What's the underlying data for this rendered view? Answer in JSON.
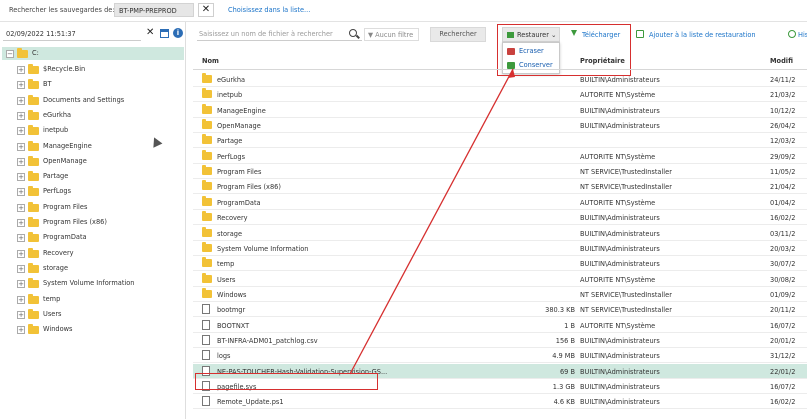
{
  "topbar": {
    "search_label": "Rechercher les sauvegardes de:",
    "server": "BT-PMP-PREPROD",
    "clear": "✕",
    "choose_link": "Choisissez dans la liste..."
  },
  "left": {
    "date": "02/09/2022 11:51:37",
    "clear": "✕",
    "info": "i",
    "root": "C:",
    "items": [
      "$Recycle.Bin",
      "BT",
      "Documents and Settings",
      "eGurkha",
      "inetpub",
      "ManageEngine",
      "OpenManage",
      "Partage",
      "PerfLogs",
      "Program Files",
      "Program Files (x86)",
      "ProgramData",
      "Recovery",
      "storage",
      "System Volume Information",
      "temp",
      "Users",
      "Windows"
    ]
  },
  "toolbar": {
    "search_placeholder": "Saisissez un nom de fichier à rechercher",
    "filter": "Aucun filtre",
    "search_button": "Rechercher",
    "restore": "Restaurer",
    "restore_menu": [
      "Ecraser",
      "Conserver"
    ],
    "download": "Télécharger",
    "add_to_list": "Ajouter à la liste de restauration",
    "history": "Histo"
  },
  "table": {
    "headers": {
      "name": "Nom",
      "owner": "Propriétaire",
      "modified": "Modifi"
    },
    "rows": [
      {
        "name": "eGurkha",
        "type": "folder",
        "size": "",
        "owner": "BUILTIN\\Administrateurs",
        "mod": "24/11/2"
      },
      {
        "name": "inetpub",
        "type": "folder",
        "size": "",
        "owner": "AUTORITE NT\\Système",
        "mod": "21/03/2"
      },
      {
        "name": "ManageEngine",
        "type": "folder",
        "size": "",
        "owner": "BUILTIN\\Administrateurs",
        "mod": "10/12/2"
      },
      {
        "name": "OpenManage",
        "type": "folder",
        "size": "",
        "owner": "BUILTIN\\Administrateurs",
        "mod": "26/04/2"
      },
      {
        "name": "Partage",
        "type": "folder",
        "size": "",
        "owner": "",
        "mod": "12/03/2"
      },
      {
        "name": "PerfLogs",
        "type": "folder",
        "size": "",
        "owner": "AUTORITE NT\\Système",
        "mod": "29/09/2"
      },
      {
        "name": "Program Files",
        "type": "folder",
        "size": "",
        "owner": "NT SERVICE\\TrustedInstaller",
        "mod": "11/05/2"
      },
      {
        "name": "Program Files (x86)",
        "type": "folder",
        "size": "",
        "owner": "NT SERVICE\\TrustedInstaller",
        "mod": "21/04/2"
      },
      {
        "name": "ProgramData",
        "type": "folder",
        "size": "",
        "owner": "AUTORITE NT\\Système",
        "mod": "01/04/2"
      },
      {
        "name": "Recovery",
        "type": "folder",
        "size": "",
        "owner": "BUILTIN\\Administrateurs",
        "mod": "16/02/2"
      },
      {
        "name": "storage",
        "type": "folder",
        "size": "",
        "owner": "BUILTIN\\Administrateurs",
        "mod": "03/11/2"
      },
      {
        "name": "System Volume Information",
        "type": "folder",
        "size": "",
        "owner": "BUILTIN\\Administrateurs",
        "mod": "20/03/2"
      },
      {
        "name": "temp",
        "type": "folder",
        "size": "",
        "owner": "BUILTIN\\Administrateurs",
        "mod": "30/07/2"
      },
      {
        "name": "Users",
        "type": "folder",
        "size": "",
        "owner": "AUTORITE NT\\Système",
        "mod": "30/08/2"
      },
      {
        "name": "Windows",
        "type": "folder",
        "size": "",
        "owner": "NT SERVICE\\TrustedInstaller",
        "mod": "01/09/2"
      },
      {
        "name": "bootmgr",
        "type": "file",
        "size": "380.3 KB",
        "owner": "NT SERVICE\\TrustedInstaller",
        "mod": "20/11/2"
      },
      {
        "name": "BOOTNXT",
        "type": "file",
        "size": "1 B",
        "owner": "AUTORITE NT\\Système",
        "mod": "16/07/2"
      },
      {
        "name": "BT-INFRA-ADM01_patchlog.csv",
        "type": "file",
        "size": "156 B",
        "owner": "BUILTIN\\Administrateurs",
        "mod": "20/01/2"
      },
      {
        "name": "logs",
        "type": "file",
        "size": "4.9 MB",
        "owner": "BUILTIN\\Administrateurs",
        "mod": "31/12/2"
      },
      {
        "name": "NE-PAS-TOUCHER-Hash-Validation-Supervision-GS...",
        "type": "file",
        "size": "69 B",
        "owner": "BUILTIN\\Administrateurs",
        "mod": "22/01/2",
        "selected": true
      },
      {
        "name": "pagefile.sys",
        "type": "file",
        "size": "1.3 GB",
        "owner": "BUILTIN\\Administrateurs",
        "mod": "16/07/2"
      },
      {
        "name": "Remote_Update.ps1",
        "type": "file",
        "size": "4.6 KB",
        "owner": "BUILTIN\\Administrateurs",
        "mod": "16/02/2"
      }
    ]
  },
  "colors": {
    "accent": "#1a73c8",
    "selection": "#cfe8df",
    "highlight": "#d62f2f",
    "folder": "#f2c237",
    "green": "#3d9a3d"
  }
}
